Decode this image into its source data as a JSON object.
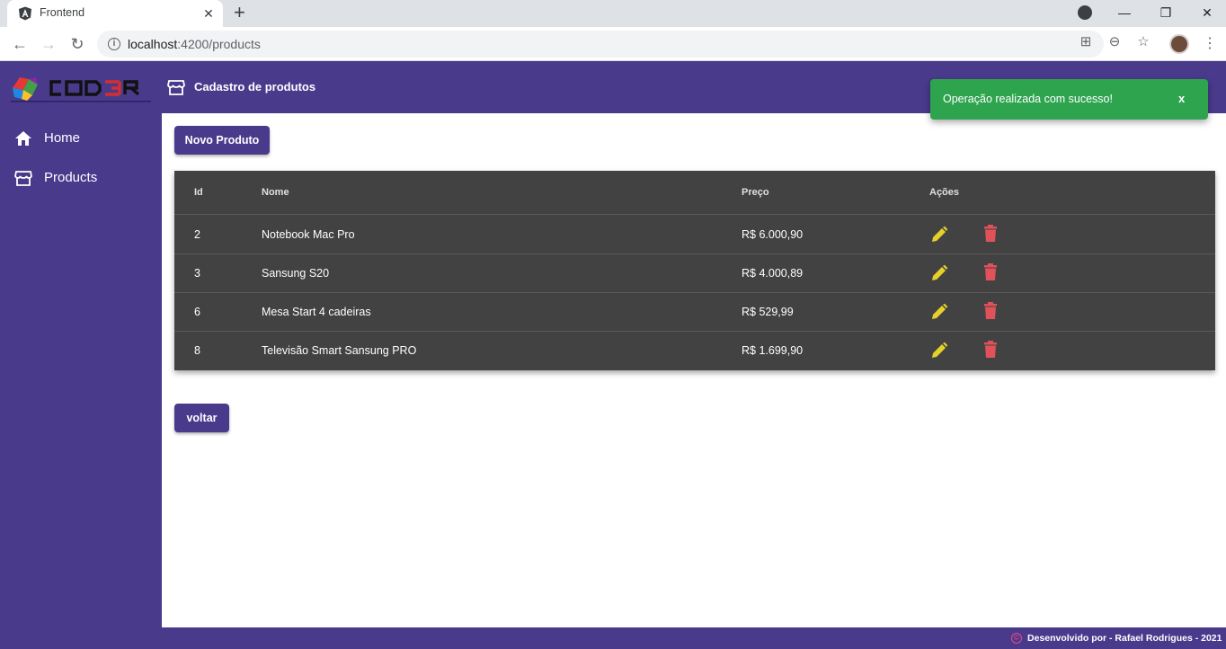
{
  "browser": {
    "tab_title": "Frontend",
    "tab_close": "✕",
    "new_tab": "+",
    "url_host": "localhost",
    "url_path": ":4200/products",
    "window_minimize": "—",
    "window_restore": "❐",
    "window_close": "✕"
  },
  "app": {
    "logo_text": "COD3R",
    "header_title": "Cadastro de produtos",
    "accent_color": "#4a3a8c"
  },
  "sidebar": {
    "items": [
      {
        "label": "Home",
        "icon": "home-icon"
      },
      {
        "label": "Products",
        "icon": "storefront-icon"
      }
    ]
  },
  "main": {
    "new_button": "Novo Produto",
    "back_button": "voltar",
    "table": {
      "headers": {
        "id": "Id",
        "name": "Nome",
        "price": "Preço",
        "actions": "Ações"
      },
      "rows": [
        {
          "id": "2",
          "name": "Notebook Mac Pro",
          "price": "R$ 6.000,90"
        },
        {
          "id": "3",
          "name": "Sansung S20",
          "price": "R$ 4.000,89"
        },
        {
          "id": "6",
          "name": "Mesa Start 4 cadeiras",
          "price": "R$ 529,99"
        },
        {
          "id": "8",
          "name": "Televisão Smart Sansung PRO",
          "price": "R$ 1.699,90"
        }
      ]
    }
  },
  "snackbar": {
    "message": "Operação realizada com sucesso!",
    "close": "x",
    "color": "#2ea44f"
  },
  "footer": {
    "text": "Desenvolvido por - Rafael Rodrigues - 2021"
  }
}
